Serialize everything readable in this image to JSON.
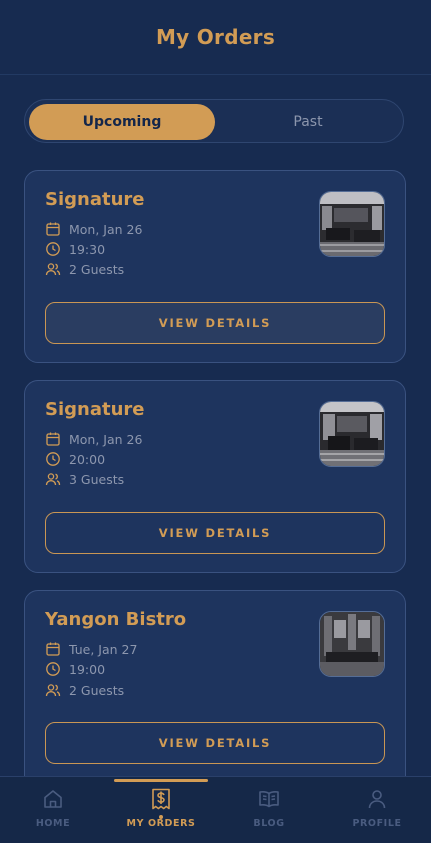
{
  "header": {
    "title": "My Orders"
  },
  "tabs": {
    "upcoming": "Upcoming",
    "past": "Past",
    "selected": "Upcoming"
  },
  "orders": [
    {
      "name": "Signature",
      "date": "Mon, Jan 26",
      "time": "19:30",
      "guests": "2 Guests",
      "button": "VIEW DETAILS"
    },
    {
      "name": "Signature",
      "date": "Mon, Jan 26",
      "time": "20:00",
      "guests": "3 Guests",
      "button": "VIEW DETAILS"
    },
    {
      "name": "Yangon Bistro",
      "date": "Tue, Jan 27",
      "time": "19:00",
      "guests": "2 Guests",
      "button": "VIEW DETAILS"
    }
  ],
  "nav": {
    "items": [
      {
        "label": "HOME",
        "icon": "home-icon"
      },
      {
        "label": "MY ORDERS",
        "icon": "receipt-dollar-icon"
      },
      {
        "label": "BLOG",
        "icon": "open-book-icon"
      },
      {
        "label": "PROFILE",
        "icon": "user-icon"
      }
    ],
    "active": "MY ORDERS"
  },
  "colors": {
    "background": "#172b50",
    "accent": "#d29c55",
    "card": "#1e345e",
    "muted": "#8d97ae"
  }
}
